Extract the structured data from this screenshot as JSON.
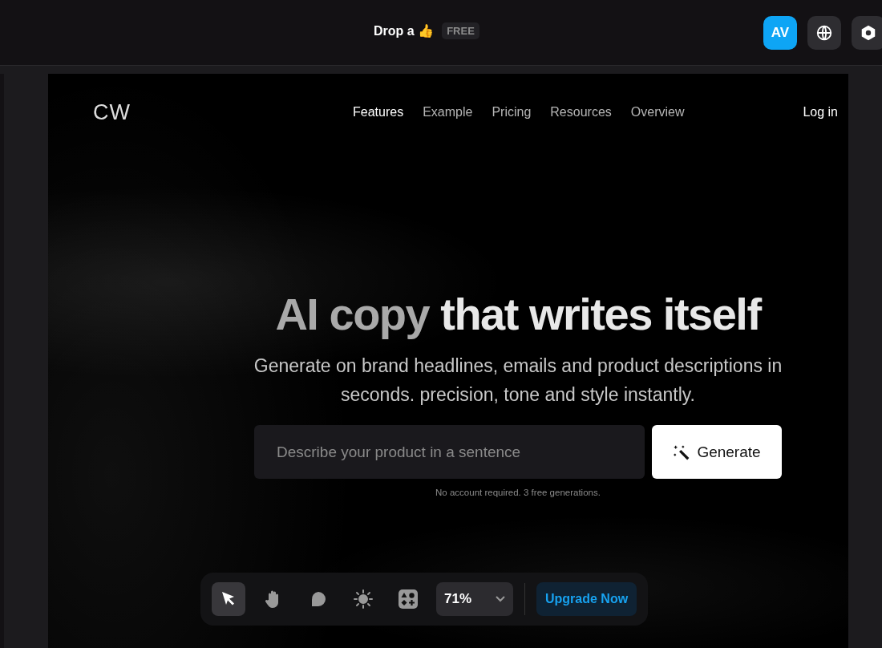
{
  "top_bar": {
    "title": "Drop a 👍",
    "badge": "FREE",
    "avatar": "AV"
  },
  "site": {
    "logo": "CW",
    "nav": [
      {
        "label": "Features",
        "selected": true
      },
      {
        "label": "Example",
        "selected": false
      },
      {
        "label": "Pricing",
        "selected": false
      },
      {
        "label": "Resources",
        "selected": false
      },
      {
        "label": "Overview",
        "selected": false
      }
    ],
    "login": "Log in"
  },
  "hero": {
    "headline_lead": "AI copy",
    "headline_rest": "that writes itself",
    "subtitle": "Generate on brand headlines, emails and product descriptions in seconds. precision, tone and style instantly.",
    "input": {
      "placeholder": "Describe your product in a sentence"
    },
    "button": "Generate",
    "note": "No account required. 3 free generations."
  },
  "toolbar": {
    "tools": [
      {
        "kind": "pointer",
        "selected": true
      },
      {
        "kind": "hand",
        "selected": false
      },
      {
        "kind": "comment",
        "selected": false
      },
      {
        "kind": "theme",
        "selected": false
      },
      {
        "kind": "shapes",
        "selected": false
      }
    ],
    "zoom": "71%",
    "upgrade": "Upgrade Now"
  }
}
